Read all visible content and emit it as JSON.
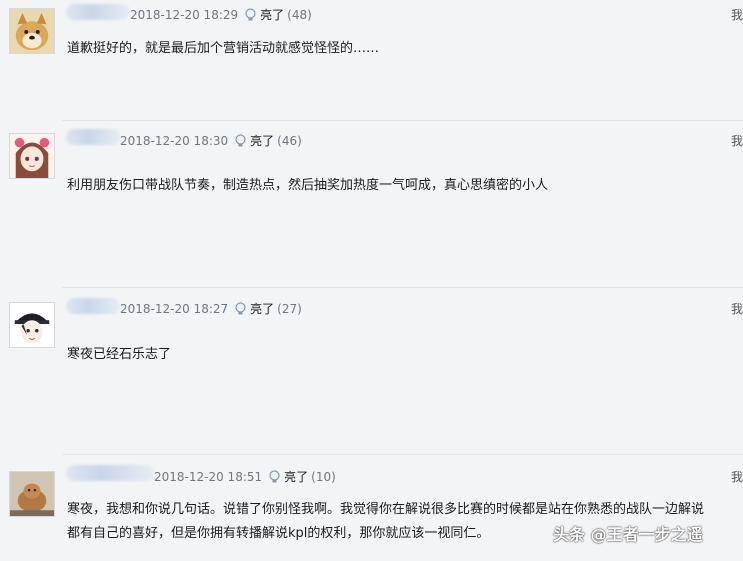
{
  "comments": [
    {
      "timestamp": "2018-12-20 18:29",
      "like_label": "亮了",
      "like_count": "(48)",
      "right_cut": "我",
      "text": "道歉挺好的，就是最后加个营销活动就感觉怪怪的……"
    },
    {
      "timestamp": "2018-12-20 18:30",
      "like_label": "亮了",
      "like_count": "(46)",
      "right_cut": "我",
      "text": "利用朋友伤口带战队节奏，制造热点，然后抽奖加热度一气呵成，真心思缜密的小人"
    },
    {
      "timestamp": "2018-12-20 18:27",
      "like_label": "亮了",
      "like_count": "(27)",
      "right_cut": "我",
      "text": "寒夜已经石乐志了"
    },
    {
      "timestamp": "2018-12-20 18:51",
      "like_label": "亮了",
      "like_count": "(10)",
      "right_cut": "我",
      "text_lines": [
        "寒夜，我想和你说几句话。说错了你别怪我啊。我觉得你在解说很多比赛的时候都是站在你熟悉的战队一边解说",
        "都有自己的喜好，但是你拥有转播解说kpl的权利，那你就应该一视同仁。"
      ]
    }
  ],
  "watermark": "头条 @王者一步之遥",
  "colors": {
    "background": "#f3f4f6",
    "meta_text": "#707780",
    "divider": "#e2e4e8"
  }
}
